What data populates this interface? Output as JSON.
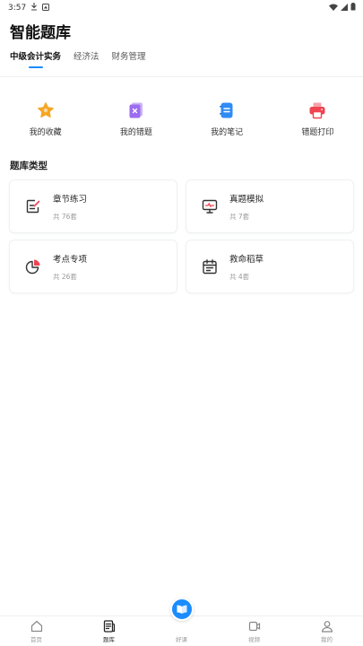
{
  "status": {
    "time": "3:57"
  },
  "title": "智能题库",
  "tabs": [
    {
      "label": "中级会计实务",
      "active": true
    },
    {
      "label": "经济法"
    },
    {
      "label": "财务管理"
    }
  ],
  "quick_actions": [
    {
      "label": "我的收藏",
      "icon": "star-icon",
      "color": "#f5a623"
    },
    {
      "label": "我的错题",
      "icon": "wrong-questions-icon",
      "color": "#9b6cf0"
    },
    {
      "label": "我的笔记",
      "icon": "notes-icon",
      "color": "#2f8cf5"
    },
    {
      "label": "错题打印",
      "icon": "printer-icon",
      "color": "#f04452"
    }
  ],
  "section_title": "题库类型",
  "cards": [
    {
      "title": "章节练习",
      "count": "共 76套",
      "icon": "edit-document-icon"
    },
    {
      "title": "真题模拟",
      "count": "共 7套",
      "icon": "monitor-icon"
    },
    {
      "title": "考点专项",
      "count": "共 26套",
      "icon": "pie-chart-icon"
    },
    {
      "title": "救命稻草",
      "count": "共 4套",
      "icon": "calendar-icon"
    }
  ],
  "nav": [
    {
      "label": "首页",
      "icon": "home-icon"
    },
    {
      "label": "题库",
      "icon": "question-bank-icon",
      "active": true
    },
    {
      "label": "好课",
      "icon": "book-icon"
    },
    {
      "label": "视频",
      "icon": "video-icon"
    },
    {
      "label": "我的",
      "icon": "user-icon"
    }
  ],
  "colors": {
    "accent": "#1a8cff"
  }
}
